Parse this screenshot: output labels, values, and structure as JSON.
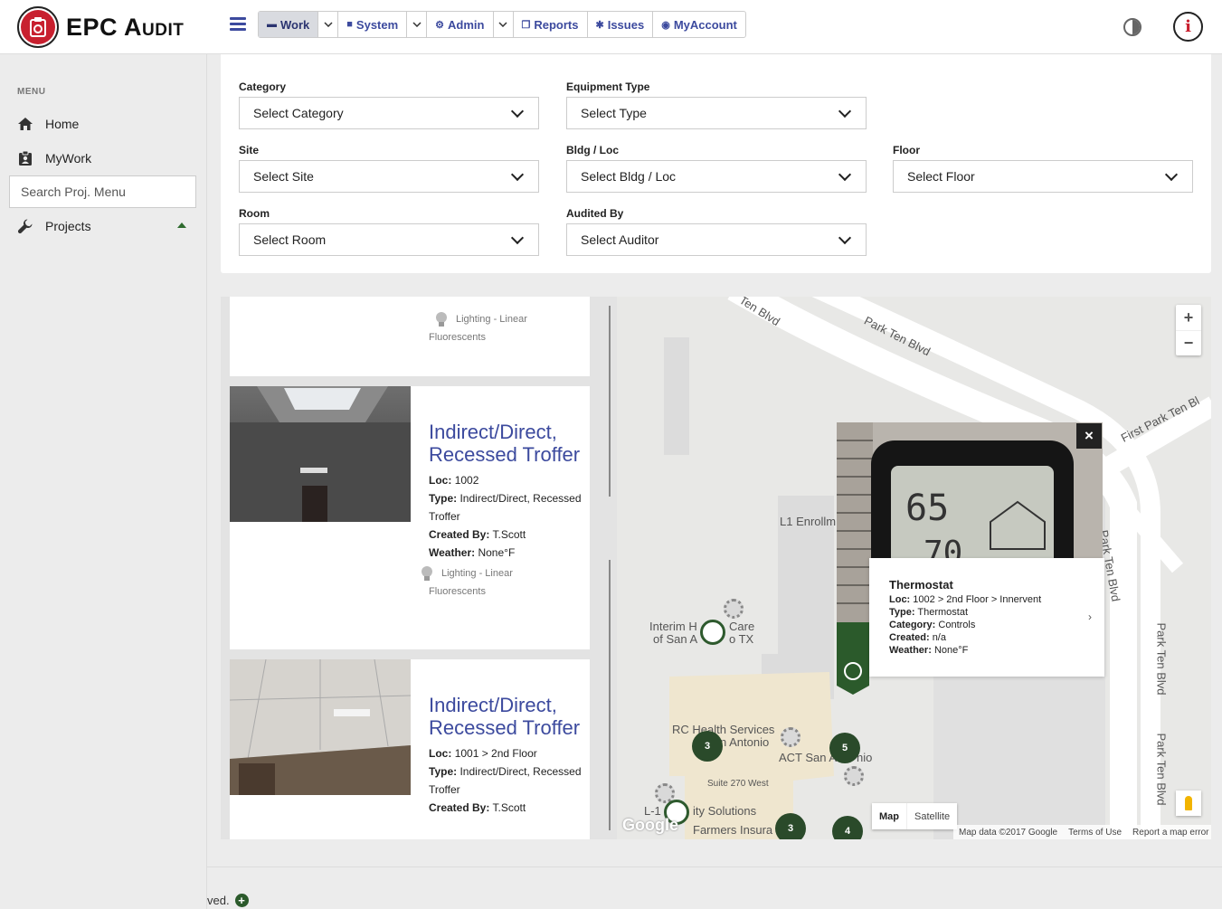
{
  "brand": {
    "name": "EPC Audit"
  },
  "nav": {
    "items": [
      {
        "label": "Work",
        "icon": "folder-icon",
        "active": true
      },
      {
        "label": "System",
        "icon": "lock-icon"
      },
      {
        "label": "Admin",
        "icon": "gears-icon"
      },
      {
        "label": "Reports",
        "icon": "copy-icon"
      },
      {
        "label": "Issues",
        "icon": "bug-icon"
      },
      {
        "label": "MyAccount",
        "icon": "user-circle-icon"
      }
    ]
  },
  "sidebar": {
    "menu_label": "MENU",
    "items": [
      {
        "label": "Home",
        "icon": "home-icon"
      },
      {
        "label": "MyWork",
        "icon": "clipboard-user-icon"
      },
      {
        "label": "Projects",
        "icon": "wrench-icon"
      }
    ],
    "search_placeholder": "Search Proj. Menu"
  },
  "filters": {
    "category": {
      "label": "Category",
      "value": "Select Category"
    },
    "equipment_type": {
      "label": "Equipment Type",
      "value": "Select Type"
    },
    "site": {
      "label": "Site",
      "value": "Select Site"
    },
    "bldg_loc": {
      "label": "Bldg / Loc",
      "value": "Select Bldg / Loc"
    },
    "floor": {
      "label": "Floor",
      "value": "Select Floor"
    },
    "room": {
      "label": "Room",
      "value": "Select Room"
    },
    "audited_by": {
      "label": "Audited By",
      "value": "Select Auditor"
    }
  },
  "list": {
    "partial_card": {
      "cat1": "Lighting - Linear",
      "cat2": "Fluorescents"
    },
    "cards": [
      {
        "title": "Indirect/Direct, Recessed Troffer",
        "loc_label": "Loc:",
        "loc": "1002",
        "type_label": "Type:",
        "type": "Indirect/Direct, Recessed Troffer",
        "created_label": "Created By:",
        "created": "T.Scott",
        "weather_label": "Weather:",
        "weather": "None°F",
        "cat1": "Lighting - Linear",
        "cat2": "Fluorescents"
      },
      {
        "title": "Indirect/Direct, Recessed Troffer",
        "loc_label": "Loc:",
        "loc": "1001 > 2nd Floor",
        "type_label": "Type:",
        "type": "Indirect/Direct, Recessed Troffer",
        "created_label": "Created By:",
        "created": "T.Scott"
      }
    ]
  },
  "map": {
    "labels": {
      "park_ten_1": "Ten Blvd",
      "park_ten_2": "Park Ten Blvd",
      "first_park": "First Park Ten Bl",
      "park_ten_v1": "Park Ten Blvd",
      "park_ten_v2": "Park Ten Blvd",
      "park_ten_v3": "Park Ten Blvd",
      "l1_enroll": "L1 Enrollm",
      "interim_1": "Interim H",
      "interim_care": "Care",
      "interim_2": "of San A",
      "interim_tx": "o TX",
      "rc_health": "RC Health Services",
      "rc_antonio": "n Antonio",
      "act_san": "ACT San A",
      "act_nio": "nio",
      "suite": "Suite 270 West",
      "l1": "L-1",
      "solutions": "ity Solutions",
      "farmers": "Farmers Insura"
    },
    "clusters": [
      "3",
      "5",
      "3",
      "4"
    ],
    "zoom_in": "+",
    "zoom_out": "−",
    "type_map": "Map",
    "type_satellite": "Satellite",
    "google": "Google",
    "footer": {
      "data": "Map data ©2017 Google",
      "terms": "Terms of Use",
      "report": "Report a map error"
    },
    "popup": {
      "title": "Thermostat",
      "loc_label": "Loc:",
      "loc": "1002 > 2nd Floor > Innervent",
      "type_label": "Type:",
      "type": "Thermostat",
      "category_label": "Category:",
      "category": "Controls",
      "created_label": "Created:",
      "created": "n/a",
      "weather_label": "Weather:",
      "weather": "None°F",
      "close": "×",
      "next": "›",
      "display_top": "65",
      "display_bottom": "70"
    }
  },
  "footer": {
    "text": "ved."
  }
}
